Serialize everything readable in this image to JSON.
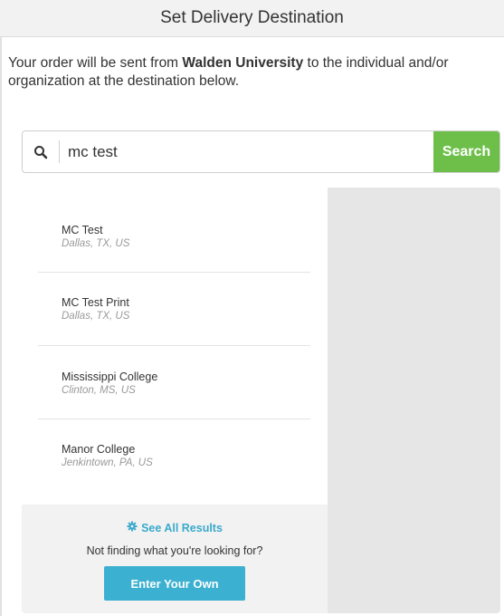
{
  "header": {
    "title": "Set Delivery Destination"
  },
  "intro": {
    "prefix": "Your order will be sent from ",
    "school": "Walden University",
    "suffix": " to the individual and/or organization at the destination below."
  },
  "search": {
    "value": "mc test",
    "button_label": "Search",
    "icon": "search-icon"
  },
  "results": [
    {
      "name": "MC Test",
      "location": "Dallas, TX, US"
    },
    {
      "name": "MC Test Print",
      "location": "Dallas, TX, US"
    },
    {
      "name": "Mississippi College",
      "location": "Clinton, MS, US"
    },
    {
      "name": "Manor College",
      "location": "Jenkintown, PA, US"
    }
  ],
  "footer": {
    "see_all_label": "See All Results",
    "see_all_icon": "gear-icon",
    "not_finding": "Not finding what you're looking for?",
    "enter_own_label": "Enter Your Own"
  },
  "colors": {
    "search_button": "#6dbf4a",
    "accent": "#3cb0d0",
    "link": "#3aaacb"
  }
}
